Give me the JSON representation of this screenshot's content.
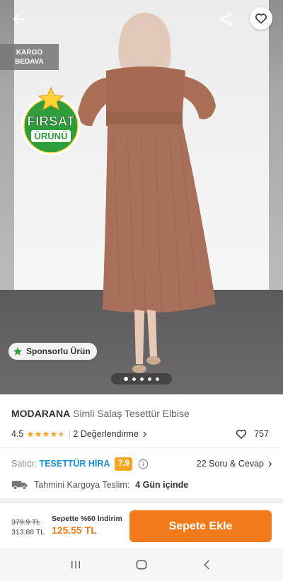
{
  "hero": {
    "kargo_line1": "KARGO",
    "kargo_line2": "BEDAVA",
    "firsat_line1": "FIRSAT",
    "firsat_line2": "ÜRÜNÜ",
    "sponsor_label": "Sponsorlu Ürün",
    "image_count": 5,
    "active_image": 1
  },
  "icons": {
    "back": "arrow-left-icon",
    "share": "share-icon",
    "favorite": "heart-outline-icon",
    "star": "star-icon",
    "truck": "truck-icon",
    "info": "info-icon"
  },
  "product": {
    "brand": "MODARANA",
    "name": "Simli Salaş Tesettür Elbise",
    "rating": "4.5",
    "rating_value": 4.5,
    "reviews_label": "2 Değerlendirme",
    "favorite_count": "757"
  },
  "seller": {
    "label": "Satıcı:",
    "name": "TESETTÜR HİRA",
    "score": "7.9",
    "qa_label": "22 Soru & Cevap"
  },
  "delivery": {
    "label": "Tahmini Kargoya Teslim:",
    "value": "4 Gün içinde"
  },
  "price": {
    "original": "379.9 TL",
    "discounted": "313.88 TL",
    "promo_label": "Sepette %60 İndirim",
    "promo_price": "125.55 TL"
  },
  "cart": {
    "button_label": "Sepete Ekle"
  },
  "colors": {
    "accent": "#f27a1a",
    "seller_link": "#1b8fd6",
    "score_bg": "#f5a623",
    "star": "#f5a623",
    "badge_green": "#2e9e3c"
  }
}
